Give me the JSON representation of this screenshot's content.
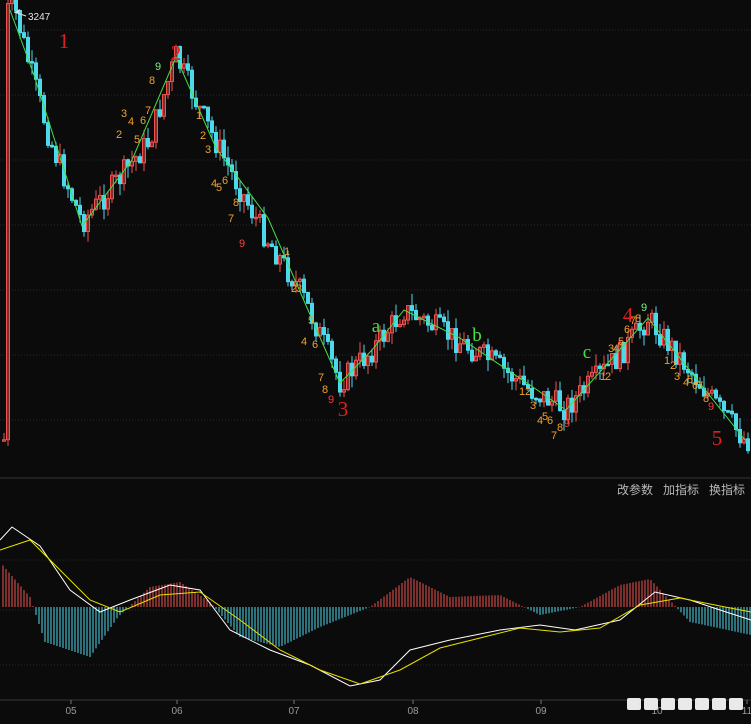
{
  "chart_data": {
    "type": "candlestick",
    "high_label": "3247",
    "months": [
      "05",
      "06",
      "07",
      "08",
      "09",
      "10",
      "11"
    ],
    "colors": {
      "up": "#ef5350",
      "down": "#4dd9ec",
      "wave_line": "#44e044",
      "wave_num_red": "#e02020",
      "wave_num_green": "#44e044",
      "seq_orange": "#f0a030",
      "seq_red": "#ff3a3a",
      "seq_green": "#7cf07c",
      "dif": "#ffffff",
      "dea": "#e8e000",
      "grid": "#2a2a2a"
    },
    "wave_labels": [
      {
        "text": "1",
        "style": "red"
      },
      {
        "text": "2",
        "style": "red"
      },
      {
        "text": "3",
        "style": "red"
      },
      {
        "text": "a",
        "style": "green"
      },
      {
        "text": "b",
        "style": "green"
      },
      {
        "text": "c",
        "style": "green"
      },
      {
        "text": "4",
        "style": "red"
      },
      {
        "text": "5",
        "style": "red"
      }
    ],
    "sequence_labels": [
      {
        "t": "3",
        "c": "seq_orange"
      },
      {
        "t": "4",
        "c": "seq_orange"
      },
      {
        "t": "2",
        "c": "seq_orange"
      },
      {
        "t": "5",
        "c": "seq_orange"
      },
      {
        "t": "6",
        "c": "seq_orange"
      },
      {
        "t": "7",
        "c": "seq_orange"
      },
      {
        "t": "8",
        "c": "seq_orange"
      },
      {
        "t": "9",
        "c": "seq_green"
      },
      {
        "t": "1",
        "c": "seq_orange"
      },
      {
        "t": "2",
        "c": "seq_orange"
      },
      {
        "t": "3",
        "c": "seq_orange"
      },
      {
        "t": "4",
        "c": "seq_orange"
      },
      {
        "t": "5",
        "c": "seq_orange"
      },
      {
        "t": "6",
        "c": "seq_orange"
      },
      {
        "t": "7",
        "c": "seq_orange"
      },
      {
        "t": "8",
        "c": "seq_orange"
      },
      {
        "t": "9",
        "c": "seq_red"
      },
      {
        "t": "1",
        "c": "seq_orange"
      },
      {
        "t": "2",
        "c": "seq_orange"
      },
      {
        "t": "3",
        "c": "seq_orange"
      },
      {
        "t": "5",
        "c": "seq_orange"
      },
      {
        "t": "4",
        "c": "seq_orange"
      },
      {
        "t": "6",
        "c": "seq_orange"
      },
      {
        "t": "7",
        "c": "seq_orange"
      },
      {
        "t": "8",
        "c": "seq_orange"
      },
      {
        "t": "9",
        "c": "seq_red"
      },
      {
        "t": "1",
        "c": "seq_orange"
      },
      {
        "t": "2",
        "c": "seq_orange"
      },
      {
        "t": "3",
        "c": "seq_orange"
      },
      {
        "t": "4",
        "c": "seq_orange"
      },
      {
        "t": "5",
        "c": "seq_orange"
      },
      {
        "t": "6",
        "c": "seq_orange"
      },
      {
        "t": "7",
        "c": "seq_orange"
      },
      {
        "t": "8",
        "c": "seq_orange"
      },
      {
        "t": "9",
        "c": "seq_red"
      },
      {
        "t": "1",
        "c": "seq_orange"
      },
      {
        "t": "2",
        "c": "seq_orange"
      },
      {
        "t": "3",
        "c": "seq_orange"
      },
      {
        "t": "4",
        "c": "seq_orange"
      },
      {
        "t": "5",
        "c": "seq_orange"
      },
      {
        "t": "6",
        "c": "seq_orange"
      },
      {
        "t": "7",
        "c": "seq_orange"
      },
      {
        "t": "8",
        "c": "seq_orange"
      },
      {
        "t": "9",
        "c": "seq_green"
      },
      {
        "t": "1",
        "c": "seq_orange"
      },
      {
        "t": "2",
        "c": "seq_orange"
      },
      {
        "t": "3",
        "c": "seq_orange"
      },
      {
        "t": "4",
        "c": "seq_orange"
      },
      {
        "t": "5",
        "c": "seq_orange"
      },
      {
        "t": "6",
        "c": "seq_orange"
      },
      {
        "t": "7",
        "c": "seq_orange"
      },
      {
        "t": "8",
        "c": "seq_orange"
      },
      {
        "t": "9",
        "c": "seq_red"
      }
    ],
    "grid": true,
    "indicator": "MACD"
  },
  "toolbar": {
    "modify_params": "改参数",
    "add_indicator": "加指标",
    "switch_indicator": "换指标"
  },
  "watermark_icon": "watermark-logo"
}
